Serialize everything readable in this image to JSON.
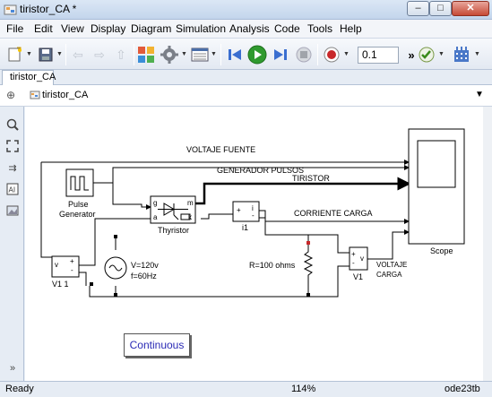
{
  "window": {
    "title": "tiristor_CA *",
    "min_symbol": "–",
    "max_symbol": "□",
    "close_symbol": "✕"
  },
  "menu": [
    "File",
    "Edit",
    "View",
    "Display",
    "Diagram",
    "Simulation",
    "Analysis",
    "Code",
    "Tools",
    "Help"
  ],
  "toolbar": {
    "stop_time": "0.1",
    "overflow": "»"
  },
  "tabs": [
    {
      "label": "tiristor_CA"
    }
  ],
  "breadcrumb": {
    "model": "tiristor_CA"
  },
  "diagram": {
    "labels": {
      "voltaje_fuente": "VOLTAJE FUENTE",
      "generador_pulsos": "GENERADOR PULSOS",
      "tiristor": "TIRISTOR",
      "corriente_carga": "CORRIENTE CARGA",
      "voltaje_carga_1": "VOLTAJE",
      "voltaje_carga_2": "CARGA"
    },
    "blocks": {
      "pulse_generator_1": "Pulse",
      "pulse_generator_2": "Generator",
      "thyristor": "Thyristor",
      "current_meas": "i1",
      "voltage_meas_left": "V1 1",
      "voltage_meas_right": "V1",
      "source_v": "V=120v",
      "source_f": "f=60Hz",
      "resistor": "R=100 ohms",
      "scope": "Scope",
      "powergui": "Continuous"
    },
    "port_labels": {
      "g": "g",
      "a": "a",
      "m": "m",
      "k": "k",
      "plus": "+",
      "minus": "-",
      "v": "v",
      "i": "i"
    }
  },
  "status": {
    "left": "Ready",
    "zoom": "114%",
    "solver": "ode23tb"
  },
  "colors": {
    "accent_green": "#2f9a2f",
    "record_red": "#c8282a",
    "continuous_text": "#2a2ab5"
  }
}
